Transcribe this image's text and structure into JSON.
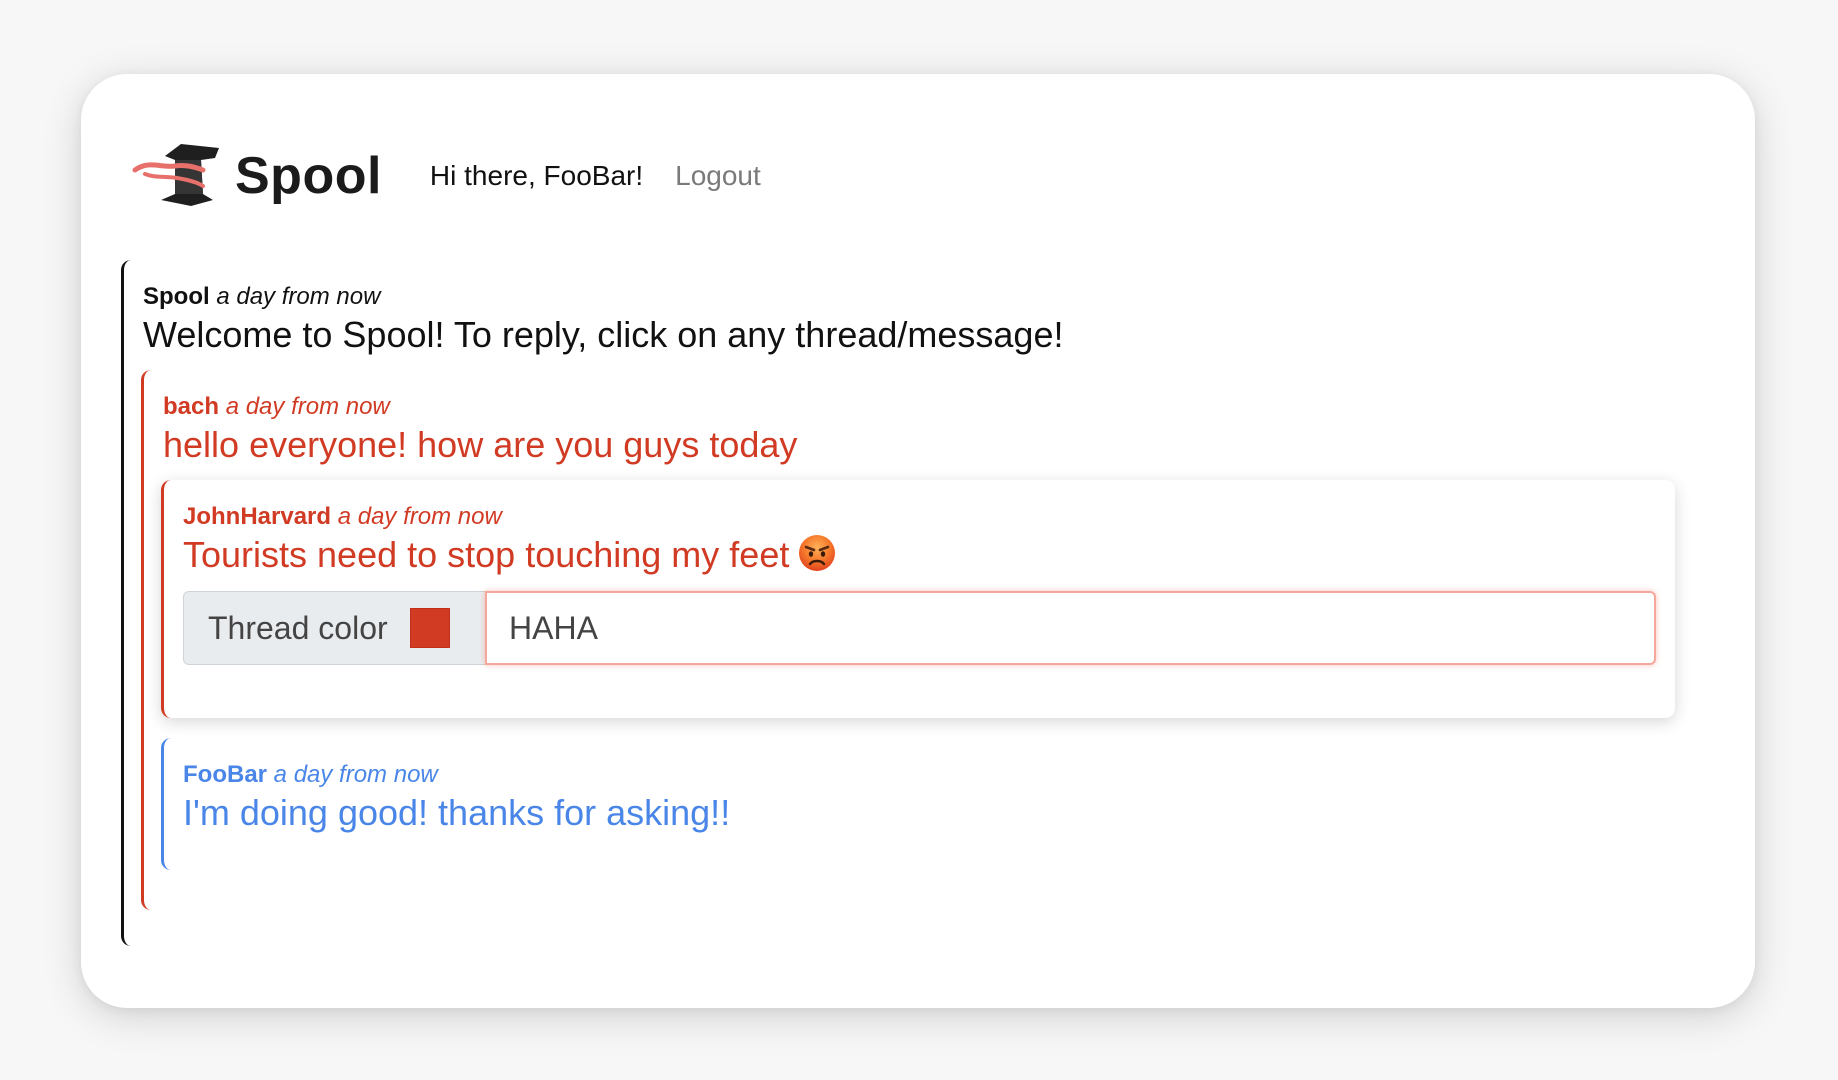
{
  "header": {
    "brand": "Spool",
    "greeting": "Hi there, FooBar!",
    "logout_label": "Logout"
  },
  "threads": {
    "root": {
      "author": "Spool",
      "time": "a day from now",
      "message": "Welcome to Spool! To reply, click on any thread/message!",
      "color": "#111111"
    },
    "bach": {
      "author": "bach",
      "time": "a day from now",
      "message": "hello everyone! how are you guys today",
      "color": "#d13a23"
    },
    "john": {
      "author": "JohnHarvard",
      "time": "a day from now",
      "message": "Tourists need to stop touching my feet",
      "emoji": "angry-face-icon",
      "color": "#d13a23"
    },
    "foobar": {
      "author": "FooBar",
      "time": "a day from now",
      "message": "I'm doing good! thanks for asking!!",
      "color": "#4a86e8"
    }
  },
  "reply": {
    "color_label": "Thread color",
    "selected_color": "#d13a23",
    "input_value": "HAHA"
  }
}
